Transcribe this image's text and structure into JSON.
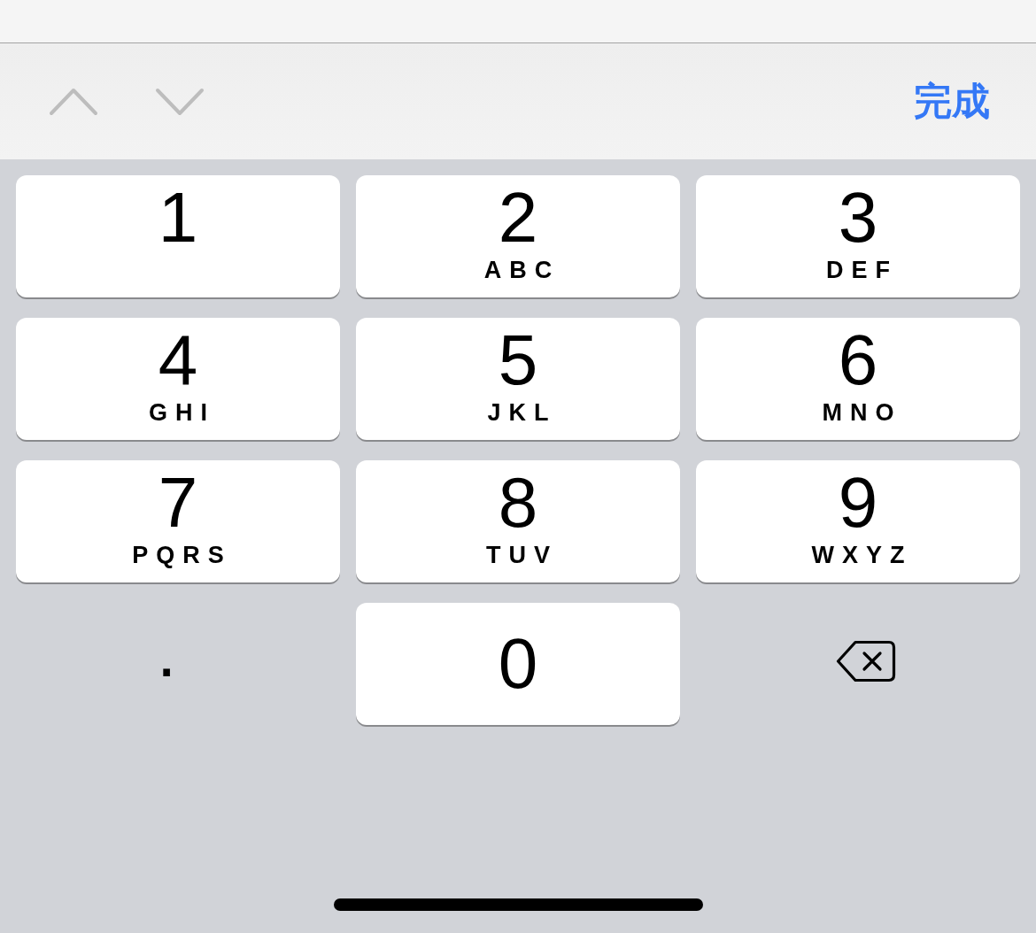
{
  "toolbar": {
    "nav_buttons": [
      {
        "kind": "previous",
        "disabled": true
      },
      {
        "kind": "next",
        "disabled": true
      }
    ],
    "done_button": {
      "label": "完成"
    }
  },
  "keypad": {
    "rows": [
      [
        {
          "kind": "lettered",
          "digit": "1"
        },
        {
          "kind": "lettered",
          "digit": "2",
          "letters": "ABC"
        },
        {
          "kind": "lettered",
          "digit": "3",
          "letters": "DEF"
        }
      ],
      [
        {
          "kind": "lettered",
          "digit": "4",
          "letters": "GHI"
        },
        {
          "kind": "lettered",
          "digit": "5",
          "letters": "JKL"
        },
        {
          "kind": "lettered",
          "digit": "6",
          "letters": "MNO"
        }
      ],
      [
        {
          "kind": "lettered",
          "digit": "7",
          "letters": "PQRS"
        },
        {
          "kind": "lettered",
          "digit": "8",
          "letters": "TUV"
        },
        {
          "kind": "lettered",
          "digit": "9",
          "letters": "WXYZ"
        }
      ],
      [
        {
          "kind": "symbol",
          "label": "."
        },
        {
          "kind": "plain",
          "digit": "0"
        },
        {
          "kind": "delete"
        }
      ]
    ]
  }
}
